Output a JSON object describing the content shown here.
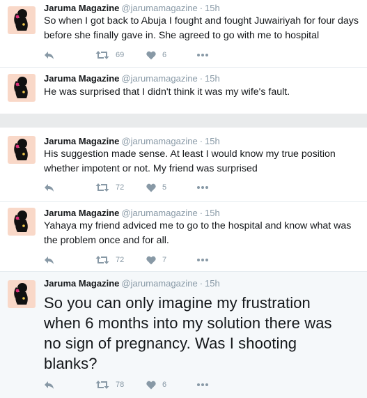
{
  "tweets": [
    {
      "name": "Jaruma Magazine",
      "handle": "@jarumamagazine",
      "time": "15h",
      "text": "So when I got back to Abuja I fought and fought Juwairiyah for four days before she finally gave in. She agreed to go with me to hospital",
      "retweets": "69",
      "likes": "6"
    },
    {
      "name": "Jaruma Magazine",
      "handle": "@jarumamagazine",
      "time": "15h",
      "text": "He was surprised that I didn't think it was my wife's fault."
    },
    {
      "name": "Jaruma Magazine",
      "handle": "@jarumamagazine",
      "time": "15h",
      "text": "His suggestion made sense. At least I would know my true position whether impotent or not. My friend was surprised",
      "retweets": "72",
      "likes": "5"
    },
    {
      "name": "Jaruma Magazine",
      "handle": "@jarumamagazine",
      "time": "15h",
      "text": "Yahaya my friend adviced me to go to the hospital and know what was the problem once and for all.",
      "retweets": "72",
      "likes": "7"
    },
    {
      "name": "Jaruma Magazine",
      "handle": "@jarumamagazine",
      "time": "15h",
      "text": "So you can only imagine my frustration when 6 months into my solution there was no sign of pregnancy. Was I shooting blanks?",
      "retweets": "78",
      "likes": "6"
    }
  ],
  "colors": {
    "avatar_bg": "#f9d8c8",
    "avatar_figure": "#111111",
    "avatar_accent": "#e0307a",
    "muted": "#8899a6",
    "text": "#14171a"
  }
}
